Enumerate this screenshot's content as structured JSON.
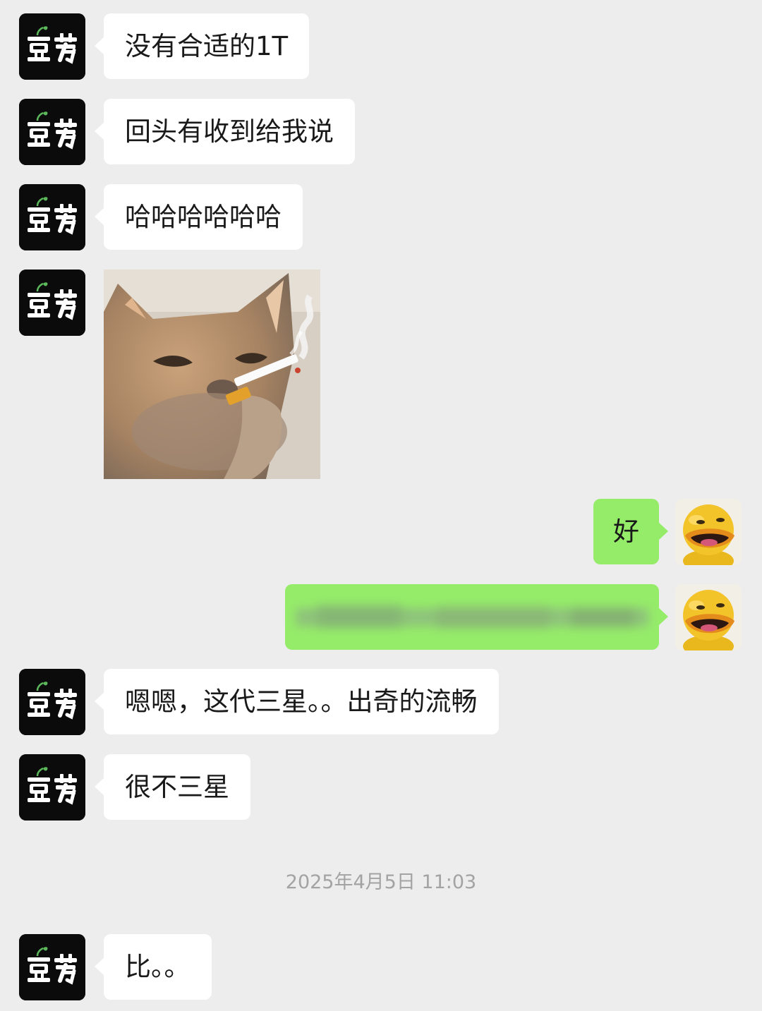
{
  "messages": [
    {
      "side": "left",
      "type": "text",
      "text": "没有合适的1T"
    },
    {
      "side": "left",
      "type": "text",
      "text": "回头有收到给我说"
    },
    {
      "side": "left",
      "type": "text",
      "text": "哈哈哈哈哈哈"
    },
    {
      "side": "left",
      "type": "sticker",
      "sticker": "cat-smoking-sticker"
    },
    {
      "side": "right",
      "type": "text",
      "text": "好"
    },
    {
      "side": "right",
      "type": "text",
      "text": "",
      "note_visible": "blurred"
    },
    {
      "side": "left",
      "type": "text",
      "text": "嗯嗯，这代三星。。出奇的流畅"
    },
    {
      "side": "left",
      "type": "text",
      "text": "很不三星"
    },
    {
      "side": "left",
      "type": "text",
      "text": "比。。"
    }
  ],
  "timestamp": "2025年4月5日 11:03",
  "avatars": {
    "left_icon": "douya-logo-icon",
    "right_icon": "yellow-duck-icon"
  },
  "colors": {
    "background": "#ededed",
    "incoming_bubble": "#ffffff",
    "outgoing_bubble": "#95ec69",
    "timestamp_text": "#a3a3a3"
  }
}
